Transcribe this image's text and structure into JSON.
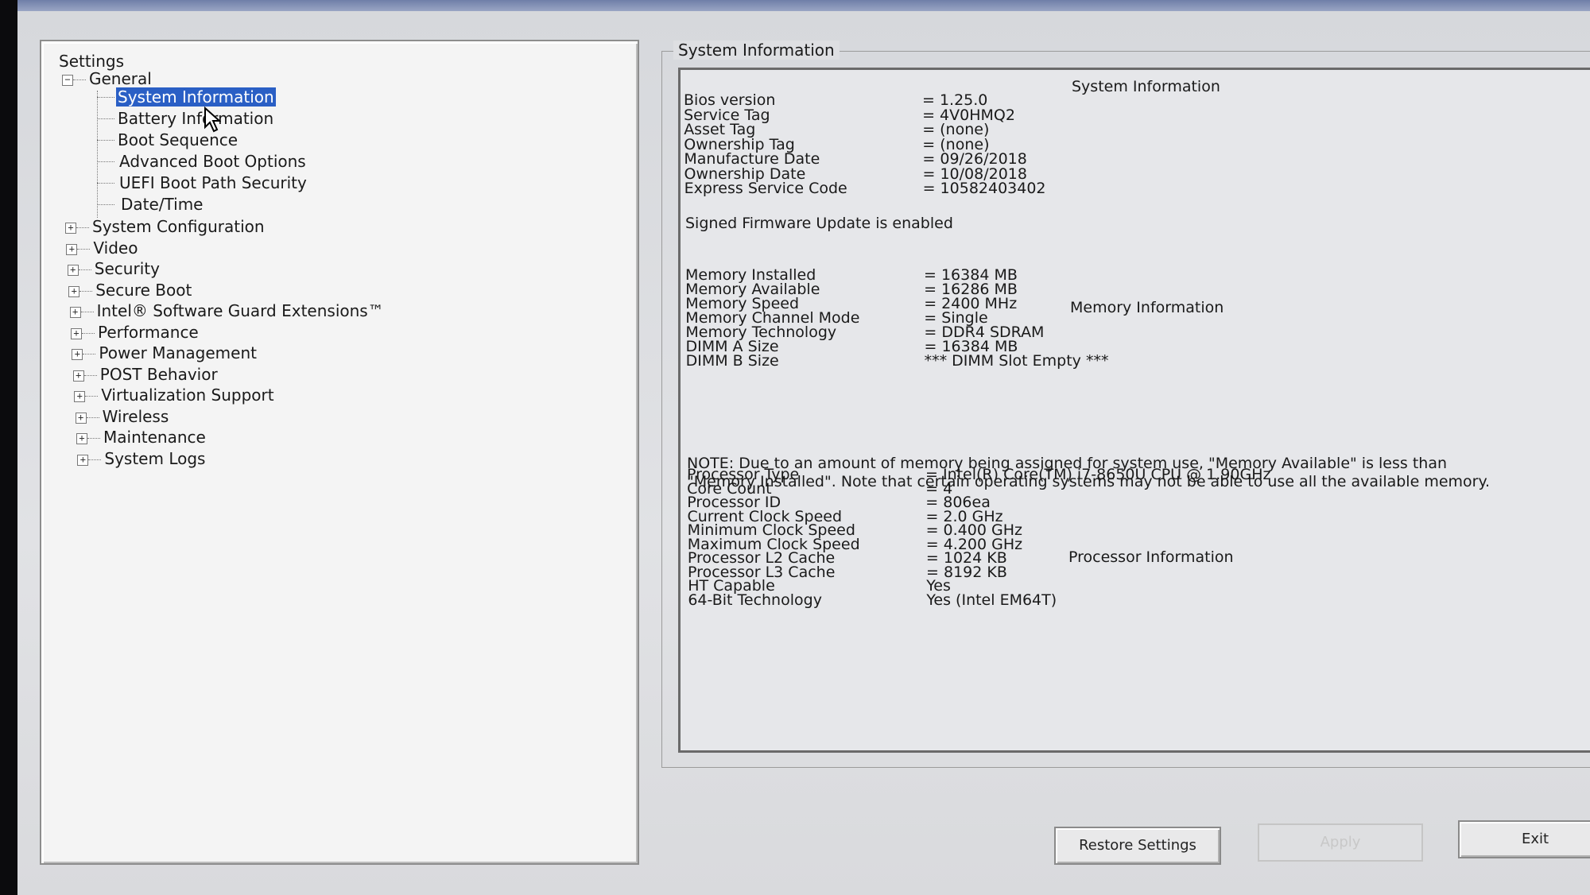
{
  "tree": {
    "root_label": "Settings",
    "general": {
      "label": "General",
      "expander": "−",
      "children": [
        "System Information",
        "Battery Information",
        "Boot Sequence",
        "Advanced Boot Options",
        "UEFI Boot Path Security",
        "Date/Time"
      ]
    },
    "collapsed_expander": "+",
    "sections": [
      "System Configuration",
      "Video",
      "Security",
      "Secure Boot",
      "Intel® Software Guard Extensions™",
      "Performance",
      "Power Management",
      "POST Behavior",
      "Virtualization Support",
      "Wireless",
      "Maintenance",
      "System Logs"
    ],
    "selected": "System Information"
  },
  "panel": {
    "group_title": "System Information",
    "system": {
      "title": "System Information",
      "rows": [
        {
          "k": "Bios version",
          "v": "= 1.25.0"
        },
        {
          "k": "Service Tag",
          "v": "= 4V0HMQ2"
        },
        {
          "k": "Asset Tag",
          "v": "= (none)"
        },
        {
          "k": "Ownership Tag",
          "v": "= (none)"
        },
        {
          "k": "Manufacture Date",
          "v": "= 09/26/2018"
        },
        {
          "k": "Ownership Date",
          "v": "= 10/08/2018"
        },
        {
          "k": "Express Service Code",
          "v": "= 10582403402"
        }
      ],
      "firmware_note": "Signed Firmware Update is enabled"
    },
    "memory": {
      "title": "Memory Information",
      "rows": [
        {
          "k": "Memory Installed",
          "v": "= 16384 MB"
        },
        {
          "k": "Memory Available",
          "v": "= 16286 MB"
        },
        {
          "k": "Memory Speed",
          "v": "= 2400 MHz"
        },
        {
          "k": "Memory Channel Mode",
          "v": "= Single"
        },
        {
          "k": "Memory Technology",
          "v": "= DDR4 SDRAM"
        },
        {
          "k": "DIMM A Size",
          "v": "= 16384 MB"
        },
        {
          "k": "DIMM B Size",
          "v": "*** DIMM Slot Empty ***"
        }
      ],
      "note": "NOTE: Due to an amount of memory being assigned for system use, \"Memory Available\" is less than \"Memory Installed\". Note that certain operating systems may not be able to use all the available memory."
    },
    "processor": {
      "title": "Processor Information",
      "rows": [
        {
          "k": "Processor Type",
          "v": "= Intel(R) Core(TM) i7-8650U CPU @ 1.90GHz"
        },
        {
          "k": "Core Count",
          "v": "= 4"
        },
        {
          "k": "Processor ID",
          "v": "= 806ea"
        },
        {
          "k": "Current Clock Speed",
          "v": "= 2.0 GHz"
        },
        {
          "k": "Minimum Clock Speed",
          "v": "= 0.400 GHz"
        },
        {
          "k": "Maximum Clock Speed",
          "v": "= 4.200 GHz"
        },
        {
          "k": "Processor L2 Cache",
          "v": "= 1024 KB"
        },
        {
          "k": "Processor L3 Cache",
          "v": "= 8192 KB"
        },
        {
          "k": "HT Capable",
          "v": "Yes"
        },
        {
          "k": "64-Bit Technology",
          "v": "Yes (Intel EM64T)"
        }
      ]
    }
  },
  "buttons": {
    "restore": "Restore Settings",
    "apply": "Apply",
    "exit": "Exit"
  },
  "icons": {
    "cursor": "mouse-pointer-icon",
    "expand": "plus-box-icon",
    "collapse": "minus-box-icon"
  },
  "colors": {
    "selection": "#2a5fc5"
  }
}
